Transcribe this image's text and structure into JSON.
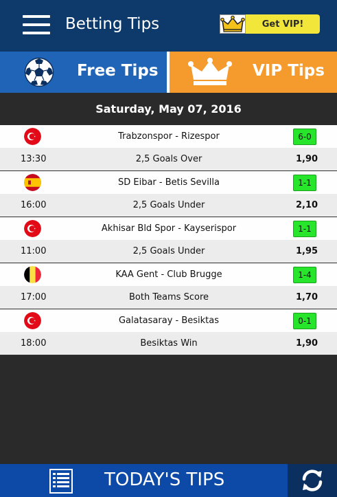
{
  "header": {
    "title": "Betting Tips",
    "vip_button": "Get VIP!"
  },
  "tabs": {
    "free": "Free Tips",
    "vip": "VIP Tips"
  },
  "date": "Saturday, May 07, 2016",
  "matches": [
    {
      "flag": "turkey-flag-icon",
      "teams": "Trabzonspor - Rizespor",
      "score": "6-0",
      "time": "13:30",
      "tip": "2,5 Goals Over",
      "odds": "1,90"
    },
    {
      "flag": "spain-flag-icon",
      "teams": "SD Eibar - Betis Sevilla",
      "score": "1-1",
      "time": "16:00",
      "tip": "2,5 Goals Under",
      "odds": "2,10"
    },
    {
      "flag": "turkey-flag-icon",
      "teams": "Akhisar Bld Spor - Kayserispor",
      "score": "1-1",
      "time": "11:00",
      "tip": "2,5 Goals Under",
      "odds": "1,95"
    },
    {
      "flag": "belgium-flag-icon",
      "teams": "KAA Gent - Club Brugge",
      "score": "1-4",
      "time": "17:00",
      "tip": "Both Teams Score",
      "odds": "1,70"
    },
    {
      "flag": "turkey-flag-icon",
      "teams": "Galatasaray - Besiktas",
      "score": "0-1",
      "time": "18:00",
      "tip": "Besiktas Win",
      "odds": "1,90"
    }
  ],
  "footer": {
    "label": "TODAY'S TIPS"
  },
  "colors": {
    "header_bg": "#0e3a6b",
    "free_tab": "#1f64b7",
    "vip_tab": "#f59b2d",
    "score_bg": "#27e52a",
    "footer_bg": "#0d4aa8"
  }
}
